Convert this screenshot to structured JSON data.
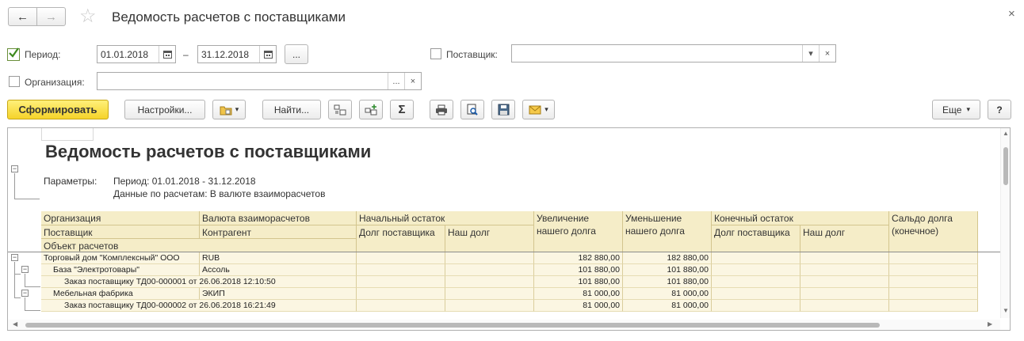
{
  "window": {
    "title": "Ведомость расчетов с поставщиками",
    "close_glyph": "×"
  },
  "nav": {
    "back_glyph": "←",
    "forward_glyph": "→",
    "star_glyph": "☆"
  },
  "filters": {
    "period_label": "Период:",
    "period_checked": true,
    "date_from": "01.01.2018",
    "date_to": "31.12.2018",
    "dash": "–",
    "period_more": "...",
    "supplier_label": "Поставщик:",
    "supplier_value": "",
    "supplier_drop": "▾",
    "supplier_clear": "×",
    "org_label": "Организация:",
    "org_value": "",
    "org_more": "...",
    "org_clear": "×"
  },
  "toolbar": {
    "generate": "Сформировать",
    "settings": "Настройки...",
    "find": "Найти...",
    "sum_glyph": "Σ",
    "more": "Еще",
    "more_arrow": "▾",
    "help": "?"
  },
  "report": {
    "title": "Ведомость расчетов с поставщиками",
    "params_label": "Параметры:",
    "param_period": "Период: 01.01.2018 - 31.12.2018",
    "param_data": "Данные по расчетам: В валюте взаиморасчетов",
    "headers": {
      "org": "Организация",
      "currency": "Валюта взаиморасчетов",
      "start_balance": "Начальный остаток",
      "increase": "Увеличение нашего долга",
      "decrease": "Уменьшение нашего долга",
      "end_balance": "Конечный остаток",
      "saldo": "Сальдо долга (конечное)",
      "supplier": "Поставщик",
      "counterparty": "Контрагент",
      "supplier_debt": "Долг поставщика",
      "our_debt": "Наш долг",
      "end_supplier_debt": "Долг поставщика",
      "end_our_debt": "Наш долг",
      "settlement_object": "Объект расчетов"
    },
    "rows": [
      {
        "name": "Торговый дом \"Комплексный\" ООО",
        "currency": "RUB",
        "increase": "182 880,00",
        "decrease": "182 880,00"
      },
      {
        "name": "База \"Электротовары\"",
        "currency": "Ассоль",
        "increase": "101 880,00",
        "decrease": "101 880,00"
      },
      {
        "name": "Заказ поставщику ТД00-000001 от 26.06.2018 12:10:50",
        "currency": "",
        "increase": "101 880,00",
        "decrease": "101 880,00"
      },
      {
        "name": "Мебельная фабрика",
        "currency": "ЭКИП",
        "increase": "81 000,00",
        "decrease": "81 000,00"
      },
      {
        "name": "Заказ поставщику ТД00-000002 от 26.06.2018 16:21:49",
        "currency": "",
        "increase": "81 000,00",
        "decrease": "81 000,00"
      }
    ],
    "collapse_glyph": "−"
  }
}
